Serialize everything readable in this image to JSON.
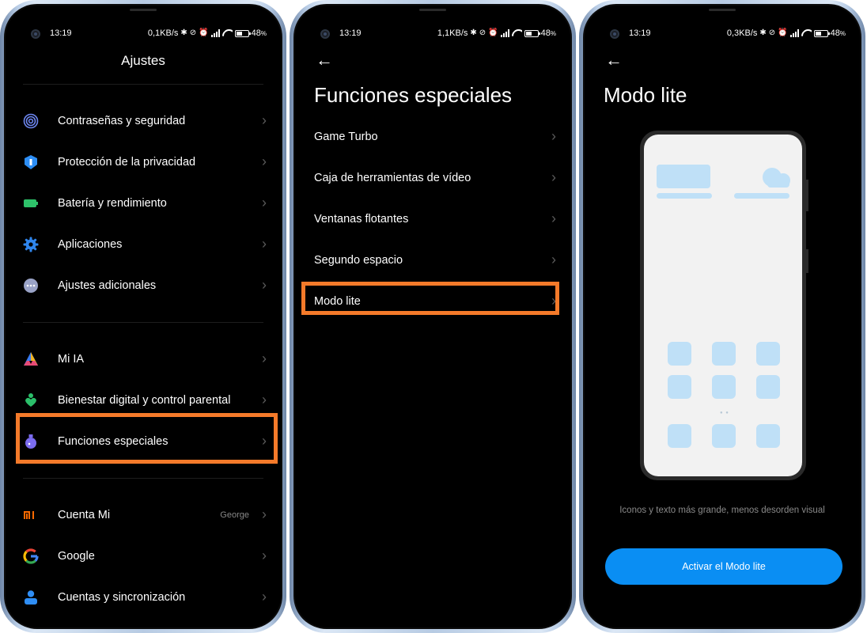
{
  "screens": [
    {
      "status": {
        "time": "13:19",
        "speed": "0,1KB/s",
        "battery": "48"
      },
      "title": "Ajustes",
      "items": [
        {
          "label": "Contraseñas y seguridad",
          "icon": "fingerprint-icon",
          "color": "#5f7fe8"
        },
        {
          "label": "Protección de la privacidad",
          "icon": "privacy-shield-icon",
          "color": "#2d8ef5"
        },
        {
          "label": "Batería y rendimiento",
          "icon": "battery-icon",
          "color": "#2ec26a"
        },
        {
          "label": "Aplicaciones",
          "icon": "gear-icon",
          "color": "#2f7fe0"
        },
        {
          "label": "Ajustes adicionales",
          "icon": "more-dots-icon",
          "color": "#9aa0b8"
        },
        {
          "label": "Mi IA",
          "icon": "mi-ai-icon",
          "color": "#e24b7a"
        },
        {
          "label": "Bienestar digital y control parental",
          "icon": "wellbeing-heart-icon",
          "color": "#2bbf6a"
        },
        {
          "label": "Funciones especiales",
          "icon": "flask-icon",
          "color": "#7b68ee"
        },
        {
          "label": "Cuenta Mi",
          "icon": "mi-logo-icon",
          "color": "#ff6a00",
          "value": "George"
        },
        {
          "label": "Google",
          "icon": "google-g-icon",
          "color": "#4285f4"
        },
        {
          "label": "Cuentas y sincronización",
          "icon": "user-icon",
          "color": "#2f8ef5"
        }
      ]
    },
    {
      "status": {
        "time": "13:19",
        "speed": "1,1KB/s",
        "battery": "48"
      },
      "back": "←",
      "title": "Funciones especiales",
      "items": [
        {
          "label": "Game Turbo"
        },
        {
          "label": "Caja de herramientas de vídeo"
        },
        {
          "label": "Ventanas flotantes"
        },
        {
          "label": "Segundo espacio"
        },
        {
          "label": "Modo lite"
        }
      ]
    },
    {
      "status": {
        "time": "13:19",
        "speed": "0,3KB/s",
        "battery": "48"
      },
      "back": "←",
      "title": "Modo lite",
      "caption": "Iconos y texto más grande, menos desorden visual",
      "button": "Activar el Modo lite"
    }
  ],
  "highlight_color": "#f47a2a",
  "accent_color": "#0a8ef3"
}
